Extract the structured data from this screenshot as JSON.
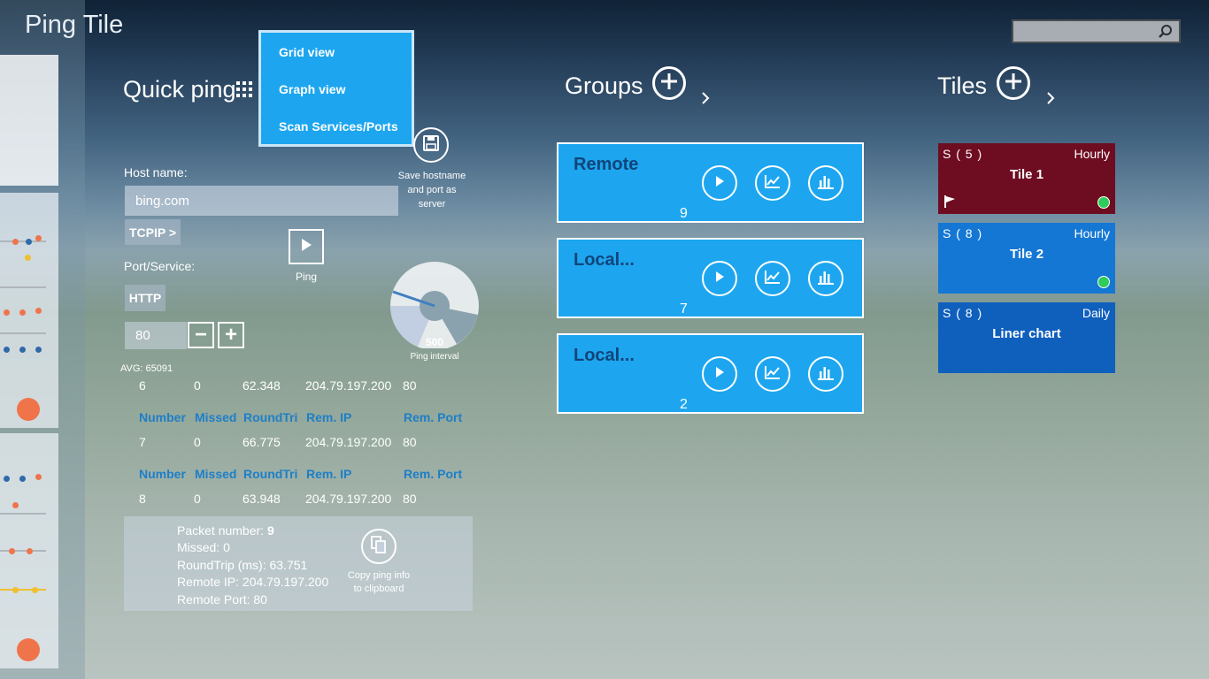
{
  "app": {
    "title": "Ping Tile"
  },
  "search": {
    "placeholder": ""
  },
  "quick_ping": {
    "title": "Quick ping",
    "host_label": "Host name:",
    "host_value": "bing.com",
    "protocol_button": "TCPIP >",
    "port_label": "Port/Service:",
    "service_button": "HTTP",
    "port_value": "80",
    "minus": "−",
    "plus": "+",
    "ping_label": "Ping",
    "save_label_line1": "Save hostname",
    "save_label_line2": "and port as",
    "save_label_line3": "server",
    "gauge_value": "500",
    "gauge_label": "Ping interval",
    "avg": "AVG: 65091"
  },
  "menu": {
    "items": [
      "Grid view",
      "Graph view",
      "Scan Services/Ports"
    ]
  },
  "table": {
    "headers": [
      "Number",
      "Missed",
      "RoundTrip",
      "Rem. IP",
      "Rem. Port"
    ],
    "rows": [
      [
        "6",
        "0",
        "62.348",
        "204.79.197.200",
        "80"
      ],
      [
        "7",
        "0",
        "66.775",
        "204.79.197.200",
        "80"
      ],
      [
        "8",
        "0",
        "63.948",
        "204.79.197.200",
        "80"
      ]
    ]
  },
  "packet_info": {
    "packet_number_label": "Packet number:",
    "packet_number": "9",
    "missed": "Missed:  0",
    "roundtrip": "RoundTrip (ms):  63.751",
    "remote_ip": "Remote IP:  204.79.197.200",
    "remote_port": "Remote Port:  80",
    "copy_line1": "Copy ping info",
    "copy_line2": "to clipboard"
  },
  "groups": {
    "title": "Groups",
    "items": [
      {
        "name": "Remote",
        "count": "9"
      },
      {
        "name": "Local...",
        "count": "7"
      },
      {
        "name": "Local...",
        "count": "2"
      }
    ]
  },
  "tiles": {
    "title": "Tiles",
    "items": [
      {
        "s": "S ( 5 )",
        "freq": "Hourly",
        "name": "Tile 1",
        "color": "#6e0d22"
      },
      {
        "s": "S ( 8 )",
        "freq": "Hourly",
        "name": "Tile 2",
        "color": "#1577d4"
      },
      {
        "s": "S ( 8 )",
        "freq": "Daily",
        "name": "Liner chart",
        "color": "#0f5fbd"
      }
    ]
  },
  "colors": {
    "accent": "#1da6ef",
    "tile_red": "#6e0d22",
    "status_green": "#2ecc5a"
  }
}
